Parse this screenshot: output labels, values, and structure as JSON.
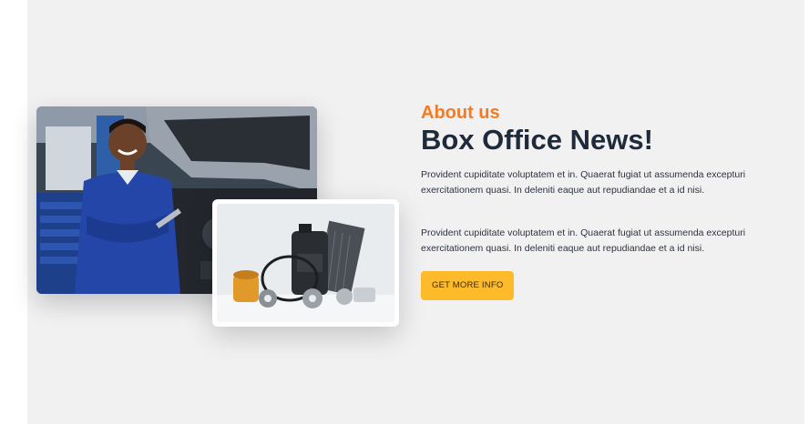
{
  "about": {
    "eyebrow": "About us",
    "title": "Box Office News!",
    "paragraphs": [
      "Provident cupiditate voluptatem et in. Quaerat fugiat ut assumenda excepturi exercitationem quasi. In deleniti eaque aut repudiandae et a id nisi.",
      "Provident cupiditate voluptatem et in. Quaerat fugiat ut assumenda excepturi exercitationem quasi. In deleniti eaque aut repudiandae et a id nisi."
    ],
    "cta_label": "GET MORE INFO"
  },
  "images": {
    "main": "mechanic-photo",
    "secondary": "car-parts-photo"
  },
  "colors": {
    "accent": "#f47b20",
    "title": "#1f2b3a",
    "button": "#fdbb2b",
    "section_bg": "#f1f1f2"
  }
}
